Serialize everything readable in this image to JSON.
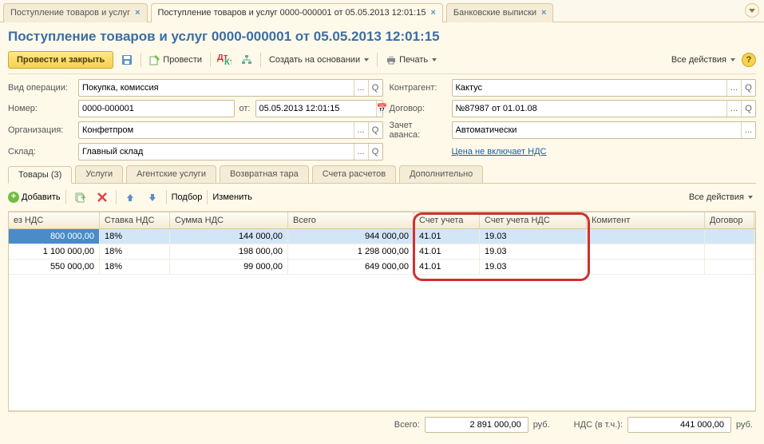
{
  "tabs": [
    {
      "label": "Поступление товаров и услуг",
      "active": false
    },
    {
      "label": "Поступление товаров и услуг 0000-000001 от 05.05.2013 12:01:15",
      "active": true
    },
    {
      "label": "Банковские выписки",
      "active": false
    }
  ],
  "title": "Поступление товаров и услуг 0000-000001 от 05.05.2013 12:01:15",
  "toolbar": {
    "post_close": "Провести и закрыть",
    "post": "Провести",
    "create_based": "Создать на основании",
    "print": "Печать",
    "all_actions": "Все действия"
  },
  "fields": {
    "op_lbl": "Вид операции:",
    "op_val": "Покупка, комиссия",
    "num_lbl": "Номер:",
    "num_val": "0000-000001",
    "date_lbl": "от:",
    "date_val": "05.05.2013 12:01:15",
    "org_lbl": "Организация:",
    "org_val": "Конфетпром",
    "wh_lbl": "Склад:",
    "wh_val": "Главный склад",
    "contr_lbl": "Контрагент:",
    "contr_val": "Кактус",
    "dog_lbl": "Договор:",
    "dog_val": "№87987 от 01.01.08",
    "avans_lbl": "Зачет аванса:",
    "avans_val": "Автоматически",
    "vat_link": "Цена не включает НДС"
  },
  "subtabs": [
    "Товары (3)",
    "Услуги",
    "Агентские услуги",
    "Возвратная тара",
    "Счета расчетов",
    "Дополнительно"
  ],
  "subtoolbar": {
    "add": "Добавить",
    "select": "Подбор",
    "edit": "Изменить",
    "all_actions": "Все действия"
  },
  "table": {
    "headers": [
      "ез НДС",
      "Ставка НДС",
      "Сумма НДС",
      "Всего",
      "Счет учета",
      "Счет учета НДС",
      "Комитент",
      "Договор"
    ],
    "rows": [
      {
        "no_vat": "800 000,00",
        "rate": "18%",
        "vat_sum": "144 000,00",
        "total": "944 000,00",
        "acc": "41.01",
        "acc_vat": "19.03",
        "kom": "",
        "dog": ""
      },
      {
        "no_vat": "1 100 000,00",
        "rate": "18%",
        "vat_sum": "198 000,00",
        "total": "1 298 000,00",
        "acc": "41.01",
        "acc_vat": "19.03",
        "kom": "",
        "dog": ""
      },
      {
        "no_vat": "550 000,00",
        "rate": "18%",
        "vat_sum": "99 000,00",
        "total": "649 000,00",
        "acc": "41.01",
        "acc_vat": "19.03",
        "kom": "",
        "dog": ""
      }
    ]
  },
  "footer": {
    "total_lbl": "Всего:",
    "total_val": "2 891 000,00",
    "total_cur": "руб.",
    "vat_lbl": "НДС (в т.ч.):",
    "vat_val": "441 000,00",
    "vat_cur": "руб."
  }
}
